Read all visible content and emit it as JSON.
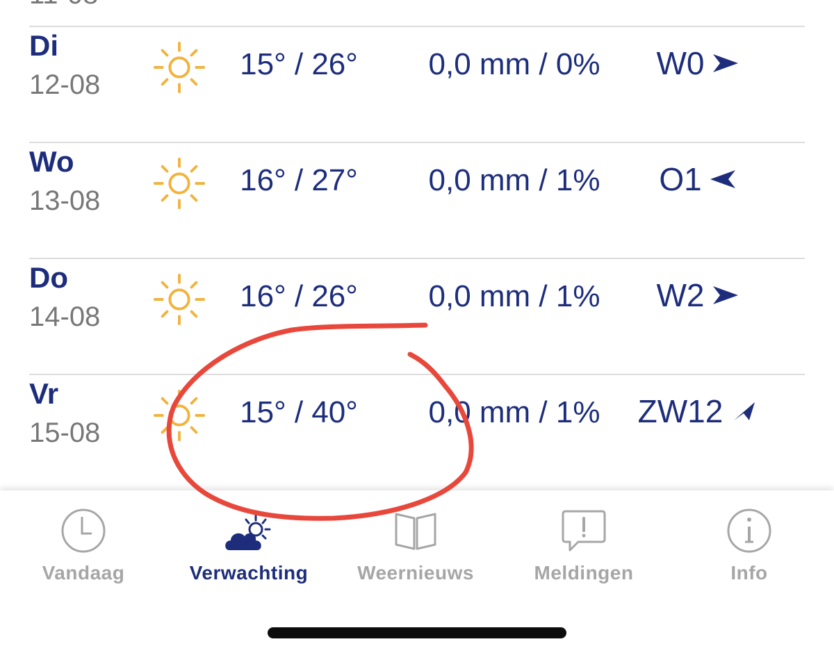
{
  "forecast": {
    "rows": [
      {
        "day": "Di",
        "date": "12-08",
        "temp": "15° / 26°",
        "rain": "0,0 mm / 0%",
        "wind": "W0"
      },
      {
        "day": "Wo",
        "date": "13-08",
        "temp": "16° / 27°",
        "rain": "0,0 mm / 1%",
        "wind": "O1"
      },
      {
        "day": "Do",
        "date": "14-08",
        "temp": "16° / 26°",
        "rain": "0,0 mm / 1%",
        "wind": "W2"
      },
      {
        "day": "Vr",
        "date": "15-08",
        "temp": "15° / 40°",
        "rain": "0,0 mm / 1%",
        "wind": "ZW12"
      }
    ],
    "weather_icon": "sun-icon",
    "wind_directions": [
      "east-arrow-icon",
      "west-arrow-icon",
      "east-arrow-icon",
      "northeast-arrow-icon"
    ]
  },
  "tabbar": {
    "tabs": [
      {
        "label": "Vandaag",
        "icon": "clock-icon"
      },
      {
        "label": "Verwachting",
        "icon": "cloud-sun-icon",
        "active": true
      },
      {
        "label": "Weernieuws",
        "icon": "book-icon"
      },
      {
        "label": "Meldingen",
        "icon": "alert-bubble-icon"
      },
      {
        "label": "Info",
        "icon": "info-icon"
      }
    ]
  },
  "colors": {
    "primary": "#1d2d7c",
    "secondary_text": "#777777",
    "inactive_tab": "#a6a6a6",
    "sun": "#f2b33d",
    "annotation": "#e8483c"
  }
}
